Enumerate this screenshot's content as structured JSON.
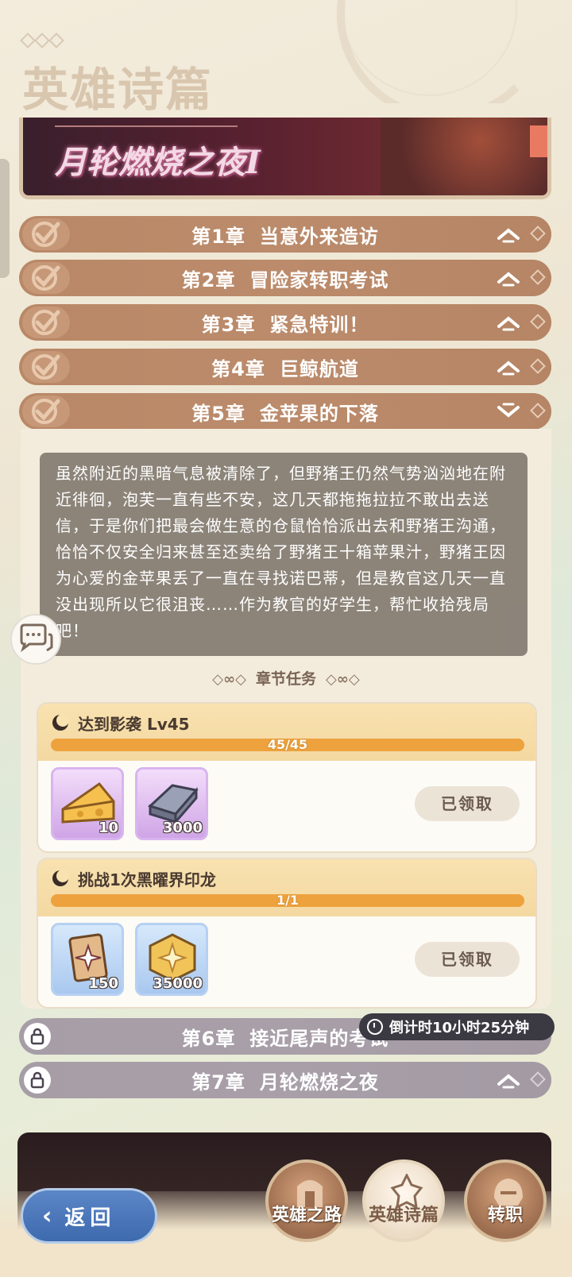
{
  "page_title": "英雄诗篇",
  "banner": {
    "title": "月轮燃烧之夜",
    "roman": "I"
  },
  "chapters": [
    {
      "num": "第1章",
      "name": "当意外来造访",
      "state": "completed"
    },
    {
      "num": "第2章",
      "name": "冒险家转职考试",
      "state": "completed"
    },
    {
      "num": "第3章",
      "name": "紧急特训！",
      "state": "completed"
    },
    {
      "num": "第4章",
      "name": "巨鲸航道",
      "state": "completed"
    },
    {
      "num": "第5章",
      "name": "金苹果的下落",
      "state": "expanded"
    },
    {
      "num": "第6章",
      "name": "接近尾声的考试",
      "state": "locked"
    },
    {
      "num": "第7章",
      "name": "月轮燃烧之夜",
      "state": "locked"
    }
  ],
  "story_text": "虽然附近的黑暗气息被清除了，但野猪王仍然气势汹汹地在附近徘徊，泡芙一直有些不安，这几天都拖拖拉拉不敢出去送信，于是你们把最会做生意的仓鼠恰恰派出去和野猪王沟通，恰恰不仅安全归来甚至还卖给了野猪王十箱苹果汁，野猪王因为心爱的金苹果丢了一直在寻找诺巴蒂，但是教官这几天一直没出现所以它很沮丧……作为教官的好学生，帮忙收拾残局吧！",
  "tasks_header": "章节任务",
  "tasks": [
    {
      "title": "达到影袭  Lv45",
      "progress_text": "45/45",
      "progress": 1.0,
      "rewards": [
        {
          "icon": "cheese-icon",
          "qty": "10",
          "frame": "purple"
        },
        {
          "icon": "iron-ingot-icon",
          "qty": "3000",
          "frame": "purple"
        }
      ],
      "button": "已领取"
    },
    {
      "title": "挑战1次黑曜界印龙",
      "progress_text": "1/1",
      "progress": 1.0,
      "rewards": [
        {
          "icon": "card-pack-icon",
          "qty": "150",
          "frame": "blue"
        },
        {
          "icon": "gold-coin-icon",
          "qty": "35000",
          "frame": "blue"
        }
      ],
      "button": "已领取"
    }
  ],
  "countdown": "倒计时10小时25分钟",
  "back_button": "返回",
  "nav": [
    {
      "label": "英雄之路",
      "active": false
    },
    {
      "label": "英雄诗篇",
      "active": true
    },
    {
      "label": "转职",
      "active": false
    }
  ]
}
